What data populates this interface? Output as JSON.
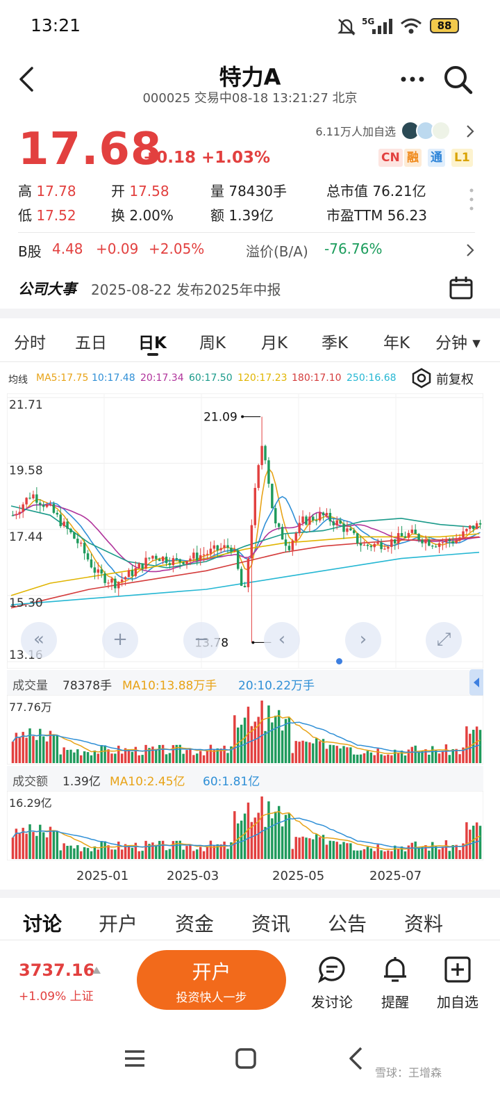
{
  "status_bar": {
    "time": "13:21",
    "network": "5G",
    "battery": "88"
  },
  "header": {
    "title": "特力A",
    "subtitle": "000025 交易中08-18 13:21:27 北京"
  },
  "quote": {
    "price": "17.68",
    "change": "+0.18 +1.03%",
    "watchers": "6.11万人加自选",
    "badges": [
      "CN",
      "融",
      "通",
      "L1"
    ]
  },
  "stats": {
    "high_label": "高",
    "high": "17.78",
    "open_label": "开",
    "open": "17.58",
    "volume_label": "量",
    "volume": "78430手",
    "mktcap_label": "总市值",
    "mktcap": "76.21亿",
    "low_label": "低",
    "low": "17.52",
    "turnover_label": "换",
    "turnover": "2.00%",
    "amount_label": "额",
    "amount": "1.39亿",
    "pe_label": "市盈TTM",
    "pe": "56.23"
  },
  "bshare": {
    "label": "B股",
    "price": "4.48",
    "change": "+0.09",
    "pct": "+2.05%",
    "premium_label": "溢价(B/A)",
    "premium": "-76.76%"
  },
  "event": {
    "label": "公司大事",
    "text": "2025-08-22 发布2025年中报"
  },
  "period_tabs": [
    "分时",
    "五日",
    "日K",
    "周K",
    "月K",
    "季K",
    "年K",
    "分钟 ▾"
  ],
  "active_period": "日K",
  "ma_legend": {
    "label": "均线",
    "items": [
      {
        "text": "MA5:17.75",
        "color": "#e8a317"
      },
      {
        "text": "10:17.48",
        "color": "#2f8fd6"
      },
      {
        "text": "20:17.34",
        "color": "#b0339b"
      },
      {
        "text": "60:17.50",
        "color": "#1a9a8a"
      },
      {
        "text": "120:17.23",
        "color": "#e0b400"
      },
      {
        "text": "180:17.10",
        "color": "#d43c3c"
      },
      {
        "text": "250:16.68",
        "color": "#25b7d3"
      }
    ],
    "adjust_label": "前复权"
  },
  "chart_data": {
    "type": "candlestick",
    "price_axis": [
      "21.71",
      "19.58",
      "17.44",
      "15.30",
      "13.16"
    ],
    "ylim": [
      13.16,
      21.71
    ],
    "annotations": [
      {
        "text": "21.09",
        "kind": "high"
      },
      {
        "text": "13.78",
        "kind": "low"
      }
    ],
    "x_ticks": [
      "2025-01",
      "2025-03",
      "2025-05",
      "2025-07"
    ],
    "ma_series_approx": [
      {
        "name": "60",
        "values": [
          18.2,
          17.9,
          17.0,
          16.4,
          16.2,
          16.4,
          16.9,
          17.3,
          17.4,
          17.7,
          17.8,
          17.6,
          17.5
        ]
      },
      {
        "name": "120",
        "values": [
          15.3,
          15.7,
          15.9,
          16.1,
          16.3,
          16.5,
          16.8,
          17.0,
          17.1,
          17.2,
          17.2,
          17.2,
          17.3
        ]
      },
      {
        "name": "180",
        "values": [
          14.9,
          15.2,
          15.5,
          15.7,
          15.9,
          16.1,
          16.4,
          16.7,
          16.9,
          17.0,
          17.1,
          17.1,
          17.2
        ]
      },
      {
        "name": "250",
        "values": [
          15.0,
          15.1,
          15.2,
          15.3,
          15.4,
          15.5,
          15.7,
          15.9,
          16.1,
          16.3,
          16.5,
          16.6,
          16.7
        ]
      }
    ]
  },
  "volume": {
    "label": "成交量",
    "value": "78378手",
    "ma10": "MA10:13.88万手",
    "ma20": "20:10.22万手",
    "max": "77.76万"
  },
  "amount_panel": {
    "label": "成交额",
    "value": "1.39亿",
    "ma10": "MA10:2.45亿",
    "ma60": "60:1.81亿",
    "max": "16.29亿"
  },
  "bottom_tabs": [
    "讨论",
    "开户",
    "资金",
    "资讯",
    "公告",
    "资料"
  ],
  "active_bottom_tab": "讨论",
  "index": {
    "value": "3737.16",
    "change": "+1.09% 上证"
  },
  "open_account": {
    "title": "开户",
    "subtitle": "投资快人一步"
  },
  "actions": [
    "发讨论",
    "提醒",
    "加自选"
  ],
  "watermark": "雪球：王增森"
}
